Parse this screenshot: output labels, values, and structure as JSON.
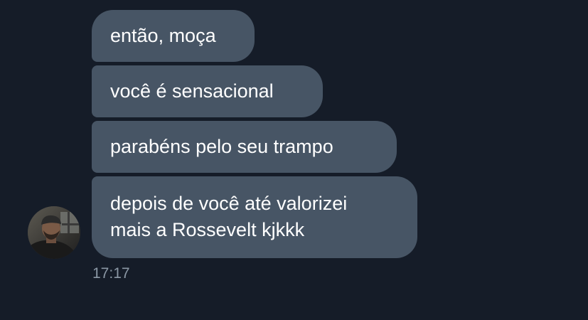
{
  "messages": [
    {
      "lines": [
        "então, moça"
      ]
    },
    {
      "lines": [
        "você é sensacional"
      ]
    },
    {
      "lines": [
        "parabéns pelo seu trampo"
      ]
    },
    {
      "lines": [
        "depois de você até valorizei",
        "mais a Rossevelt kjkkk"
      ]
    }
  ],
  "timestamp": "17:17",
  "colors": {
    "background": "#151c28",
    "bubble": "#475565",
    "text": "#ffffff",
    "timestamp": "#8b98a5"
  }
}
